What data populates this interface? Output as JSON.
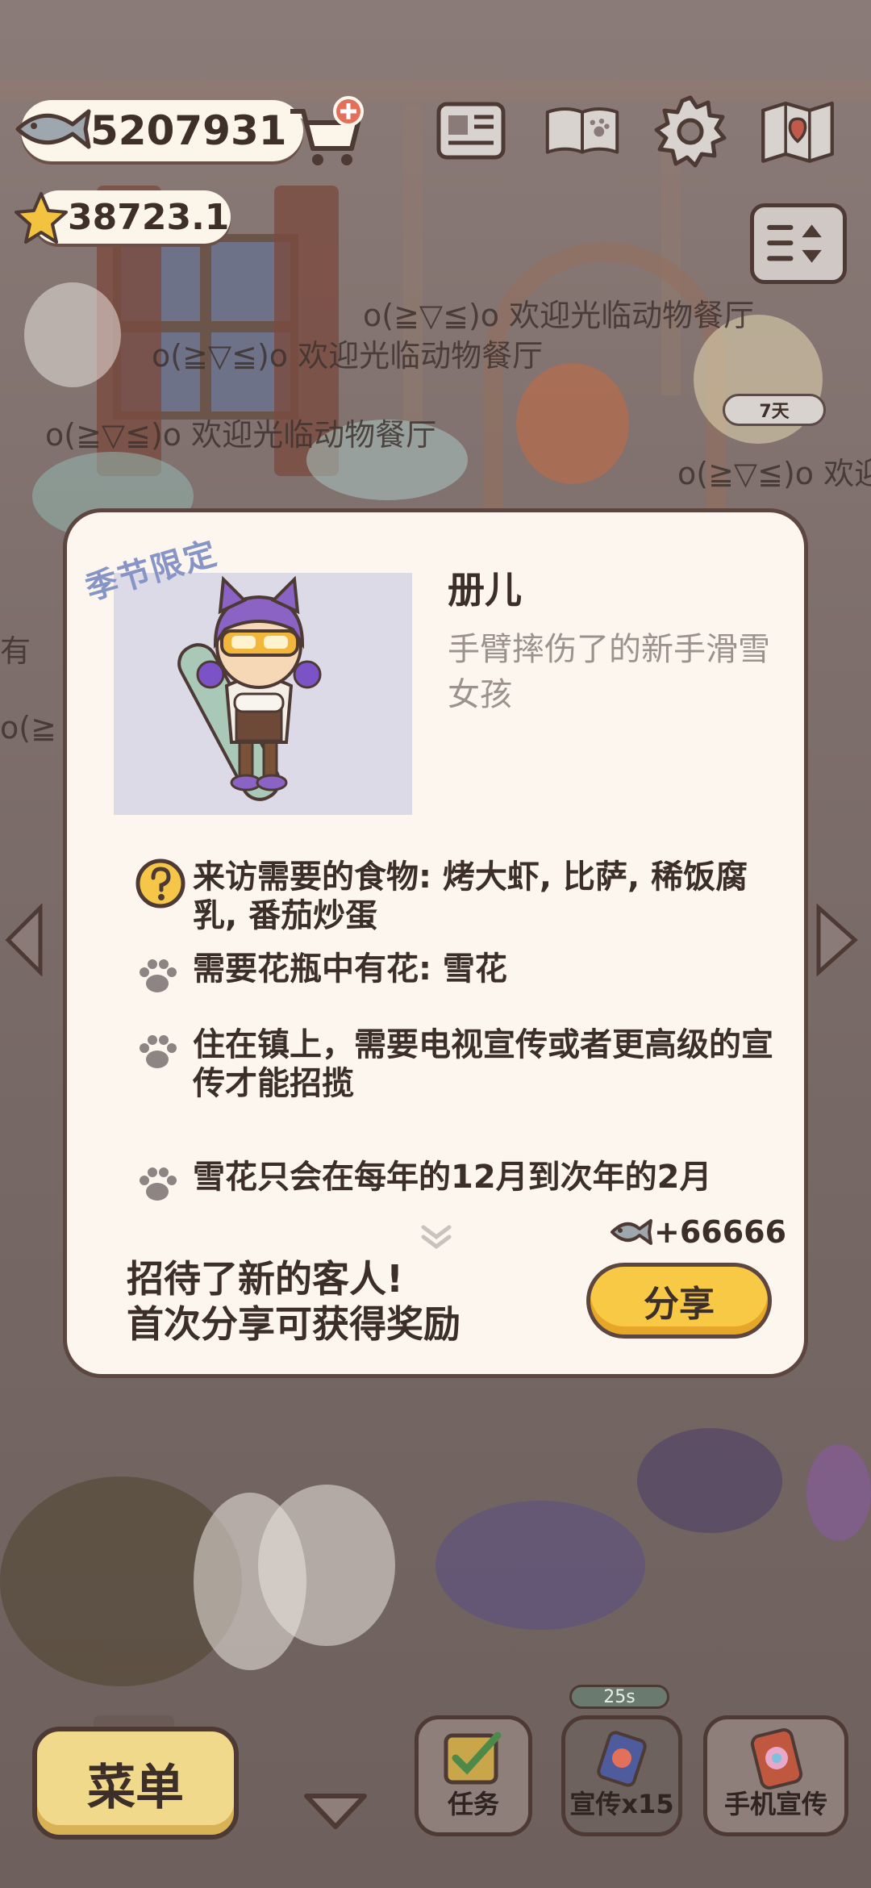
{
  "hud": {
    "fish_count": "5207931",
    "star_count": "38723.1",
    "days_badge": "7天"
  },
  "scene": {
    "welcome_messages": [
      "o(≧▽≦)o 欢迎光临动物餐厅",
      "o(≧▽≦)o 欢迎光临动物餐厅",
      "o(≧▽≦)o 欢迎光临动物餐厅",
      "o(≧▽≦)o 欢迎",
      "o(≧",
      "有"
    ]
  },
  "dialog": {
    "season_tag": "季节限定",
    "name": "册儿",
    "description": "手臂摔伤了的新手滑雪女孩",
    "requirements": [
      "来访需要的食物: 烤大虾, 比萨, 稀饭腐乳, 番茄炒蛋",
      "需要花瓶中有花: 雪花",
      "住在镇上，需要电视宣传或者更高级的宣传才能招揽",
      "雪花只会在每年的12月到次年的2月"
    ],
    "reward": "+66666",
    "share_message_line1": "招待了新的客人!",
    "share_message_line2": "首次分享可获得奖励",
    "share_button": "分享"
  },
  "bottom": {
    "menu_label": "菜单",
    "task_label": "任务",
    "promo_label": "宣传x15",
    "promo_timer": "25s",
    "phone_promo_label": "手机宣传"
  },
  "colors": {
    "dialog_bg": "#fcf6ee",
    "share_button": "#f7c944",
    "portrait_bg": "#dddae8",
    "season_tag": "#8794c6"
  }
}
